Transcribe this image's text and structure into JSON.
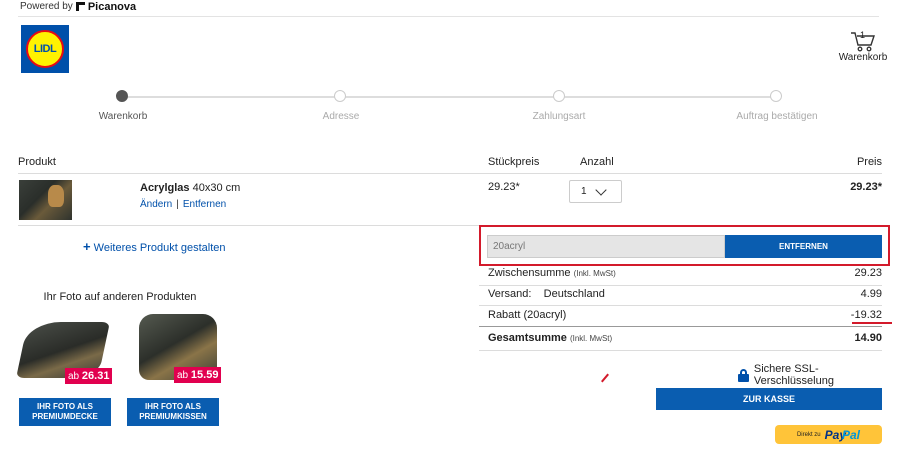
{
  "header": {
    "powered_by": "Powered by",
    "brand": "Picanova",
    "logo_text": "LIDL",
    "cart_count": "1",
    "cart_label": "Warenkorb"
  },
  "steps": [
    {
      "label": "Warenkorb",
      "active": true
    },
    {
      "label": "Adresse",
      "active": false
    },
    {
      "label": "Zahlungsart",
      "active": false
    },
    {
      "label": "Auftrag bestätigen",
      "active": false
    }
  ],
  "table": {
    "col_product": "Produkt",
    "col_unit": "Stückpreis",
    "col_qty": "Anzahl",
    "col_price": "Preis"
  },
  "item": {
    "name_bold": "Acrylglas",
    "name_size": " 40x30 cm",
    "edit": "Ändern",
    "separator": "|",
    "remove": "Entfernen",
    "unit_price": "29.23*",
    "quantity": "1",
    "price": "29.23*"
  },
  "more_product": {
    "plus": "+",
    "label": " Weiteres Produkt gestalten"
  },
  "other": {
    "title": "Ihr Foto auf anderen Produkten",
    "products": [
      {
        "prefix": "ab ",
        "price": "26.31",
        "button_line1": "IHR FOTO ALS",
        "button_line2": "PREMIUMDECKE"
      },
      {
        "prefix": "ab ",
        "price": "15.59",
        "button_line1": "IHR FOTO ALS",
        "button_line2": "PREMIUMKISSEN"
      }
    ]
  },
  "coupon": {
    "value": "20acryl",
    "button": "ENTFERNEN"
  },
  "summary": {
    "subtotal_label": "Zwischensumme",
    "subtotal_note": "(Inkl. MwSt)",
    "subtotal": "29.23",
    "shipping_label": "Versand:",
    "shipping_country": "Deutschland",
    "shipping": "4.99",
    "discount_label": "Rabatt (20acryl)",
    "discount": "-19.32",
    "total_label": "Gesamtsumme",
    "total_note": "(Inkl. MwSt)",
    "total": "14.90"
  },
  "checkout": {
    "ssl": "Sichere SSL-Verschlüsselung",
    "button": "ZUR KASSE",
    "paypal_small": "Direkt zu",
    "paypal_1": "Pay",
    "paypal_2": "Pal"
  },
  "colors": {
    "brand_blue": "#0050aa",
    "button_blue": "#0a5db0",
    "highlight_red": "#d31a2b",
    "badge_pink": "#e1004f",
    "paypal_yellow": "#ffc439"
  }
}
